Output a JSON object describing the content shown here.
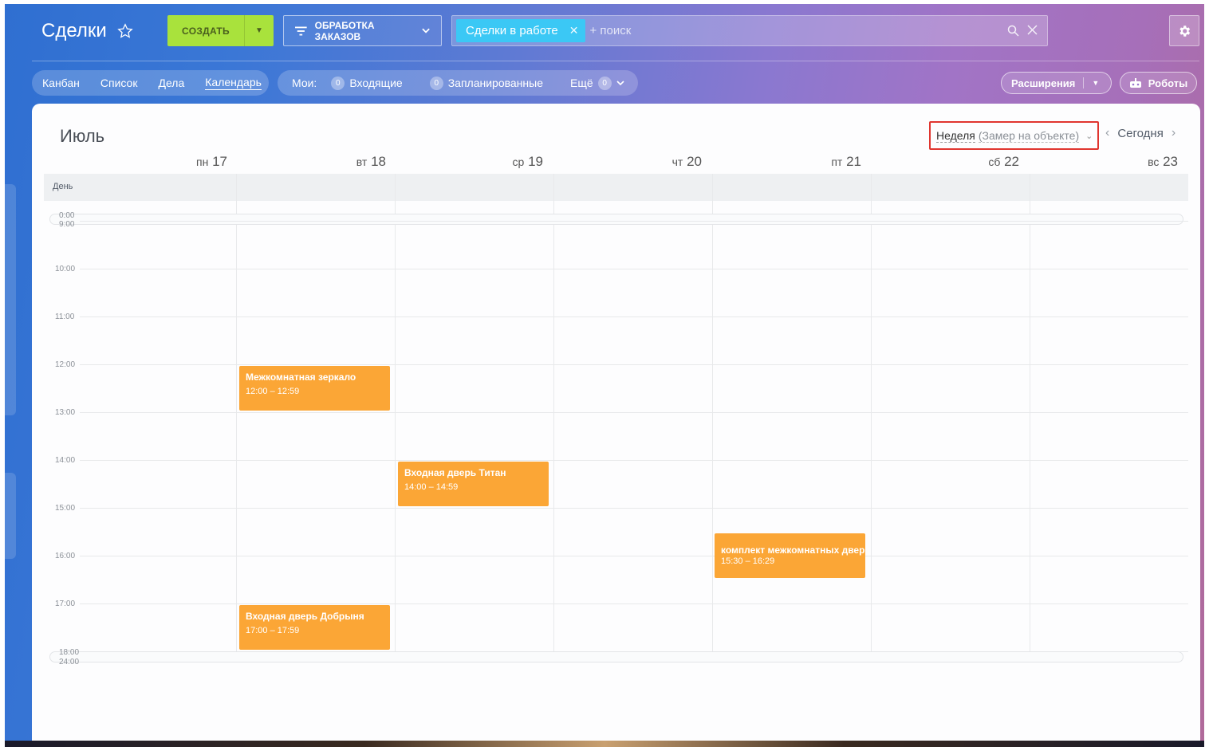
{
  "header": {
    "title": "Сделки",
    "create_label": "СОЗДАТЬ",
    "pipeline_label": "ОБРАБОТКА ЗАКАЗОВ",
    "filter_chip": "Сделки в работе",
    "search_placeholder": "+ поиск"
  },
  "view_tabs": [
    "Канбан",
    "Список",
    "Дела",
    "Календарь"
  ],
  "active_view": "Календарь",
  "counters": {
    "label": "Мои:",
    "items": [
      {
        "count": "0",
        "label": "Входящие"
      },
      {
        "count": "0",
        "label": "Запланированные"
      }
    ],
    "more_label": "Ещё",
    "more_count": "0"
  },
  "toolbar_right": {
    "extensions_label": "Расширения",
    "robots_label": "Роботы"
  },
  "calendar": {
    "month": "Июль",
    "week_label": "Неделя",
    "week_filter": "(Замер на объекте)",
    "today_label": "Сегодня",
    "allday_label": "День",
    "days": [
      {
        "dow": "пн",
        "date": "17"
      },
      {
        "dow": "вт",
        "date": "18"
      },
      {
        "dow": "ср",
        "date": "19"
      },
      {
        "dow": "чт",
        "date": "20"
      },
      {
        "dow": "пт",
        "date": "21"
      },
      {
        "dow": "сб",
        "date": "22"
      },
      {
        "dow": "вс",
        "date": "23"
      }
    ],
    "collapsed_top": [
      "0:00",
      "9:00"
    ],
    "hours": [
      "10:00",
      "11:00",
      "12:00",
      "13:00",
      "14:00",
      "15:00",
      "16:00",
      "17:00"
    ],
    "collapsed_bottom": [
      "18:00",
      "24:00"
    ],
    "events": [
      {
        "title": "Межкомнатная зеркало",
        "time": "12:00 – 12:59"
      },
      {
        "title": "Входная дверь Титан",
        "time": "14:00 – 14:59"
      },
      {
        "title": "комплект межкомнатных дверей",
        "time": "15:30 – 16:29"
      },
      {
        "title": "Входная дверь Добрыня",
        "time": "17:00 – 17:59"
      }
    ]
  },
  "colors": {
    "create_button": "#a9e23c",
    "filter_chip": "#3bc8f5",
    "event": "#fba636",
    "highlight_border": "#e0352f"
  }
}
